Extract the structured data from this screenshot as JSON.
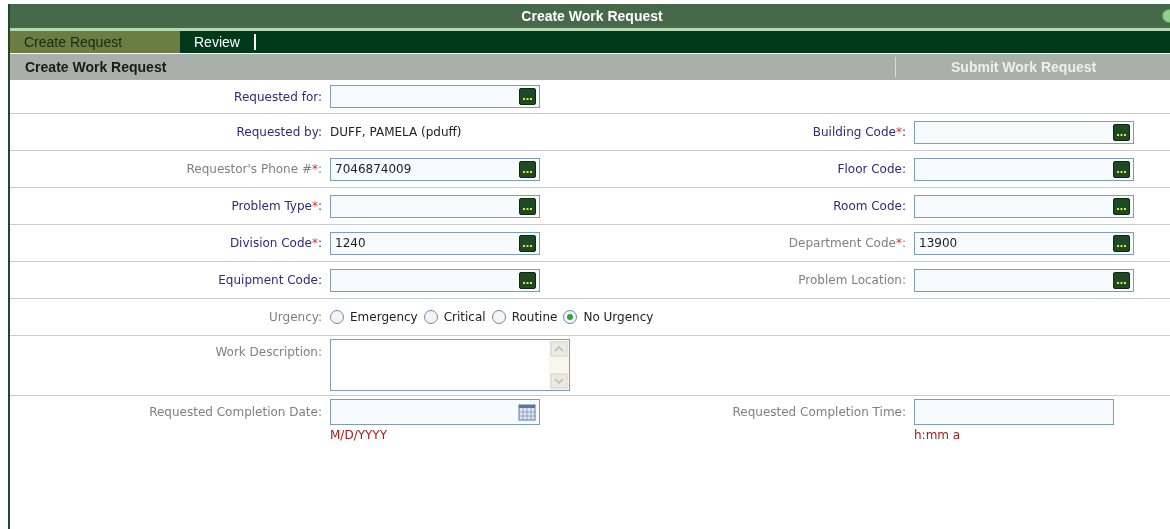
{
  "window": {
    "title": "Create Work Request"
  },
  "tabs": [
    {
      "label": "Create Request",
      "selected": true
    },
    {
      "label": "Review",
      "selected": false
    }
  ],
  "section": {
    "title": "Create Work Request",
    "action": "Submit Work Request"
  },
  "rows": [
    {
      "left": {
        "kind": "lookup",
        "label": "Requested for:",
        "link": true
      },
      "right": null
    },
    {
      "left": {
        "kind": "readonly",
        "label": "Requested by:",
        "link": true,
        "value": "DUFF, PAMELA (pduff)"
      },
      "right": {
        "kind": "lookup",
        "label": "Building Code",
        "link": true,
        "required_mark": "*",
        "suffix": ":"
      }
    },
    {
      "left": {
        "kind": "lookup",
        "label": "Requestor's Phone #",
        "link": false,
        "required_mark": "*",
        "suffix": ":",
        "value": "7046874009"
      },
      "right": {
        "kind": "lookup",
        "label": "Floor Code:",
        "link": true
      }
    },
    {
      "left": {
        "kind": "lookup",
        "label": "Problem Type",
        "link": true,
        "required_mark": "*",
        "suffix": ":"
      },
      "right": {
        "kind": "lookup",
        "label": "Room Code:",
        "link": true
      }
    },
    {
      "left": {
        "kind": "lookup",
        "label": "Division Code",
        "link": true,
        "required_mark": "*",
        "suffix": ":",
        "value": "1240"
      },
      "right": {
        "kind": "lookup",
        "label": "Department Code",
        "link": false,
        "required_mark": "*",
        "suffix": ":",
        "value": "13900"
      }
    },
    {
      "left": {
        "kind": "lookup",
        "label": "Equipment Code:",
        "link": true
      },
      "right": {
        "kind": "lookup",
        "label": "Problem Location:",
        "link": false
      }
    },
    {
      "left": {
        "kind": "radio",
        "label": "Urgency:",
        "link": false,
        "options": [
          {
            "label": "Emergency",
            "selected": false
          },
          {
            "label": "Critical",
            "selected": false
          },
          {
            "label": "Routine",
            "selected": false
          },
          {
            "label": "No Urgency",
            "selected": true
          }
        ]
      },
      "right": null
    },
    {
      "left": {
        "kind": "textarea",
        "label": "Work Description:",
        "link": false
      },
      "right": null
    },
    {
      "left": {
        "kind": "date",
        "label": "Requested Completion Date:",
        "link": false,
        "hint": "M/D/YYYY"
      },
      "right": {
        "kind": "time",
        "label": "Requested Completion Time:",
        "link": false,
        "hint": "h:mm a"
      }
    }
  ]
}
